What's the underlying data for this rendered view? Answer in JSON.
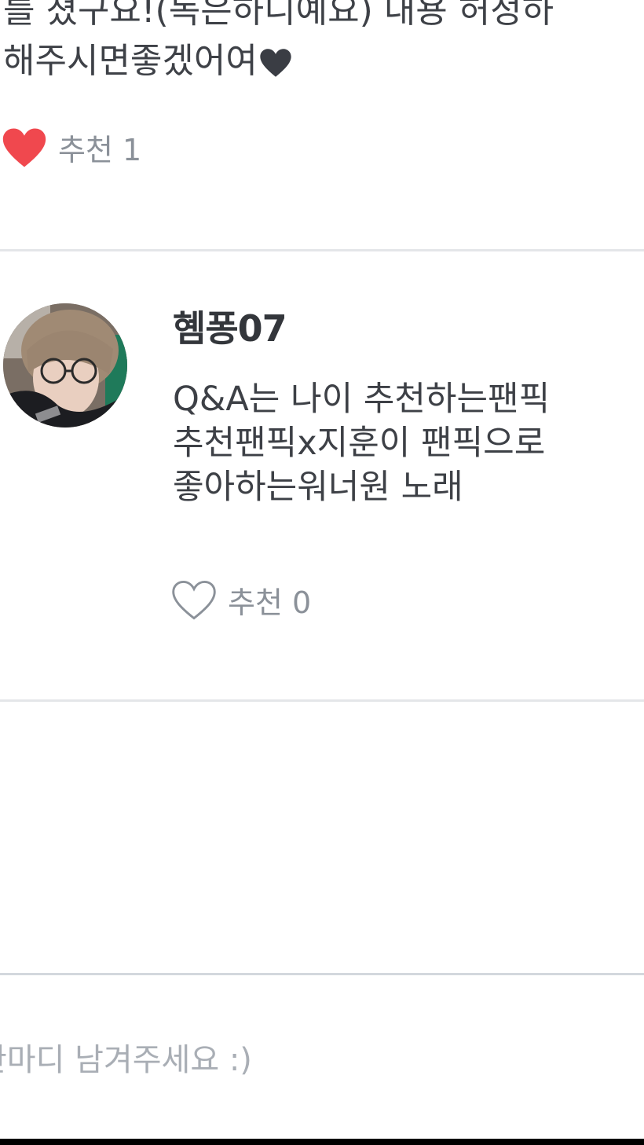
{
  "previous_comment": {
    "lines": [
      "를 쳤구요!(독은하니예요) 내용 허정하",
      "해주시면좋겠어여"
    ],
    "like_label": "추천",
    "like_count": "1",
    "liked": true
  },
  "comment": {
    "author": "혬퐁07",
    "lines": [
      "Q&A는 나이 추천하는팬픽",
      "추천팬픽x지훈이 팬픽으로",
      "좋아하는워너원 노래"
    ],
    "like_label": "추천",
    "like_count": "0",
    "liked": false
  },
  "input": {
    "placeholder": "한마디 남겨주세요 :)"
  },
  "colors": {
    "heart_filled": "#f0484e",
    "heart_outline": "#8b9199",
    "divider": "#e4e6e9",
    "placeholder": "#a9aeb5"
  }
}
